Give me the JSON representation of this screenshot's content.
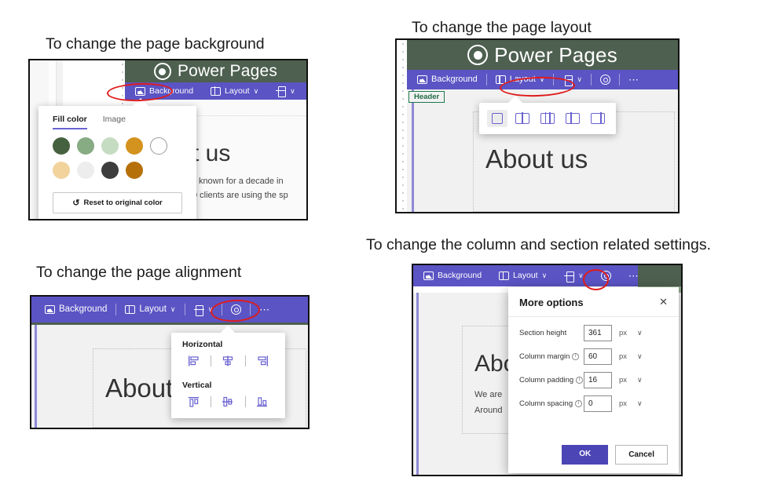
{
  "captions": {
    "background": "To change the page background",
    "layout": "To change the page layout",
    "alignment": "To change the page alignment",
    "more": "To change the column and section related settings."
  },
  "app": {
    "title": "Power Pages",
    "logo_icon": "power-pages-logo-icon"
  },
  "toolbar": {
    "background_label": "Background",
    "background_icon": "background-image-icon",
    "layout_label": "Layout",
    "layout_icon": "layout-columns-icon",
    "align_icon": "alignment-icon",
    "settings_icon": "gear-icon",
    "overflow_icon": "ellipsis-icon",
    "chevron": "∨"
  },
  "fill_flyout": {
    "tabs": [
      {
        "label": "Fill color",
        "active": true
      },
      {
        "label": "Image",
        "active": false
      }
    ],
    "swatches_row1": [
      {
        "name": "dark-green",
        "color": "#46613f"
      },
      {
        "name": "medium-green",
        "color": "#87ab83"
      },
      {
        "name": "light-green",
        "color": "#c6dcc2"
      },
      {
        "name": "amber",
        "color": "#d4921f"
      },
      {
        "name": "white",
        "color": "#ffffff",
        "outline": true
      }
    ],
    "swatches_row2": [
      {
        "name": "tan",
        "color": "#f2d39c"
      },
      {
        "name": "off-white",
        "color": "#ededed"
      },
      {
        "name": "dark-gray",
        "color": "#3d3d3d"
      },
      {
        "name": "dark-orange",
        "color": "#b5700a"
      }
    ],
    "reset_label": "Reset to original color",
    "reset_icon": "undo-icon"
  },
  "layout_flyout": {
    "options": [
      {
        "name": "layout-one-column",
        "selected": true
      },
      {
        "name": "layout-two-column",
        "selected": false
      },
      {
        "name": "layout-three-column",
        "selected": false
      },
      {
        "name": "layout-left-narrow",
        "selected": false
      },
      {
        "name": "layout-right-narrow",
        "selected": false
      }
    ]
  },
  "align_flyout": {
    "horizontal_label": "Horizontal",
    "vertical_label": "Vertical",
    "horizontal_options": [
      {
        "name": "align-left-icon"
      },
      {
        "name": "align-center-icon"
      },
      {
        "name": "align-right-icon"
      }
    ],
    "vertical_options": [
      {
        "name": "align-top-icon"
      },
      {
        "name": "align-middle-icon"
      },
      {
        "name": "align-bottom-icon"
      }
    ]
  },
  "more_options": {
    "title": "More options",
    "close_icon": "close-icon",
    "fields": [
      {
        "label": "Section height",
        "value": "361",
        "unit": "px",
        "has_info": false
      },
      {
        "label": "Column margin",
        "value": "60",
        "unit": "px",
        "has_info": true
      },
      {
        "label": "Column padding",
        "value": "16",
        "unit": "px",
        "has_info": true
      },
      {
        "label": "Column spacing",
        "value": "0",
        "unit": "px",
        "has_info": true
      }
    ],
    "ok_label": "OK",
    "cancel_label": "Cancel",
    "info_glyph": "i"
  },
  "canvas": {
    "header_tag": "Header",
    "about_title": "About us",
    "about_title_clipped_1": "t us",
    "about_title_clipped_2": "Abo",
    "about_title_clipped_3": "Abou",
    "body_line1_clipped": "ll known for a decade in",
    "body_line2_clipped": "0 clients are using the sp",
    "body_line1_short": "We are",
    "body_line2_short": "Around"
  },
  "colors": {
    "brand_purple": "#5b54c4",
    "header_green": "#4e6050",
    "accent_violet": "#6a62d0",
    "annotation_red": "#e01b1b",
    "primary_button": "#4b45b5"
  }
}
